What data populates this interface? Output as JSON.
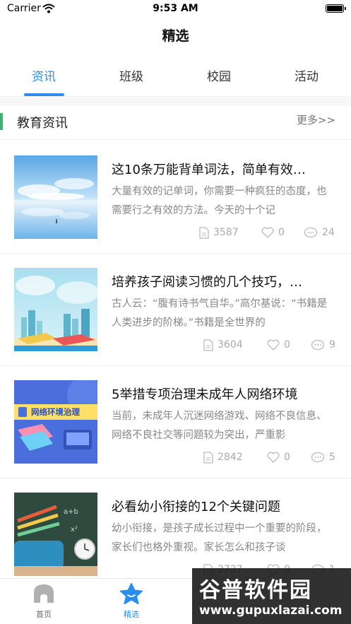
{
  "status_bar": {
    "carrier": "Carrier",
    "time": "9:53 AM"
  },
  "nav": {
    "title": "精选"
  },
  "tabs": [
    {
      "label": "资讯",
      "active": true
    },
    {
      "label": "班级",
      "active": false
    },
    {
      "label": "校园",
      "active": false
    },
    {
      "label": "活动",
      "active": false
    }
  ],
  "section": {
    "title": "教育资讯",
    "more": "更多>>"
  },
  "articles": [
    {
      "title": "这10条万能背单词法，简单有效…",
      "summary": "大量有效的记单词，你需要一种疯狂的态度，也需要行之有效的方法。今天的十个记",
      "views": "3587",
      "likes": "0",
      "comments": "24",
      "image": "sky-reflection"
    },
    {
      "title": "培养孩子阅读习惯的几个技巧，…",
      "summary": "古人云：“腹有诗书气自华。”高尔基说：“书籍是人类进步的阶梯。”书籍是全世界的",
      "views": "3604",
      "likes": "0",
      "comments": "9",
      "image": "city-books"
    },
    {
      "title": "5举措专项治理未成年人网络环境",
      "summary": "当前，未成年人沉迷网络游戏、网络不良信息、网络不良社交等问题较为突出，严重影",
      "views": "2842",
      "likes": "0",
      "comments": "5",
      "image": "network-banner",
      "image_text": "网络环境治理"
    },
    {
      "title": "必看幼小衔接的12个关键问题",
      "summary": "幼小衔接，是孩子成长过程中一个重要的阶段，家长们也格外重视。家长怎么和孩子谈",
      "views": "2727",
      "likes": "0",
      "comments": "1",
      "image": "classroom-pencils"
    }
  ],
  "tabbar": [
    {
      "label": "首页",
      "icon": "home-icon",
      "active": false
    },
    {
      "label": "精选",
      "icon": "star-icon",
      "active": true
    }
  ],
  "watermark": {
    "line1": "谷普软件园",
    "line2": "www.gupuxlazai.com"
  },
  "colors": {
    "accent": "#2c8df0",
    "section_bar": "#3cb371",
    "muted": "#888888"
  }
}
